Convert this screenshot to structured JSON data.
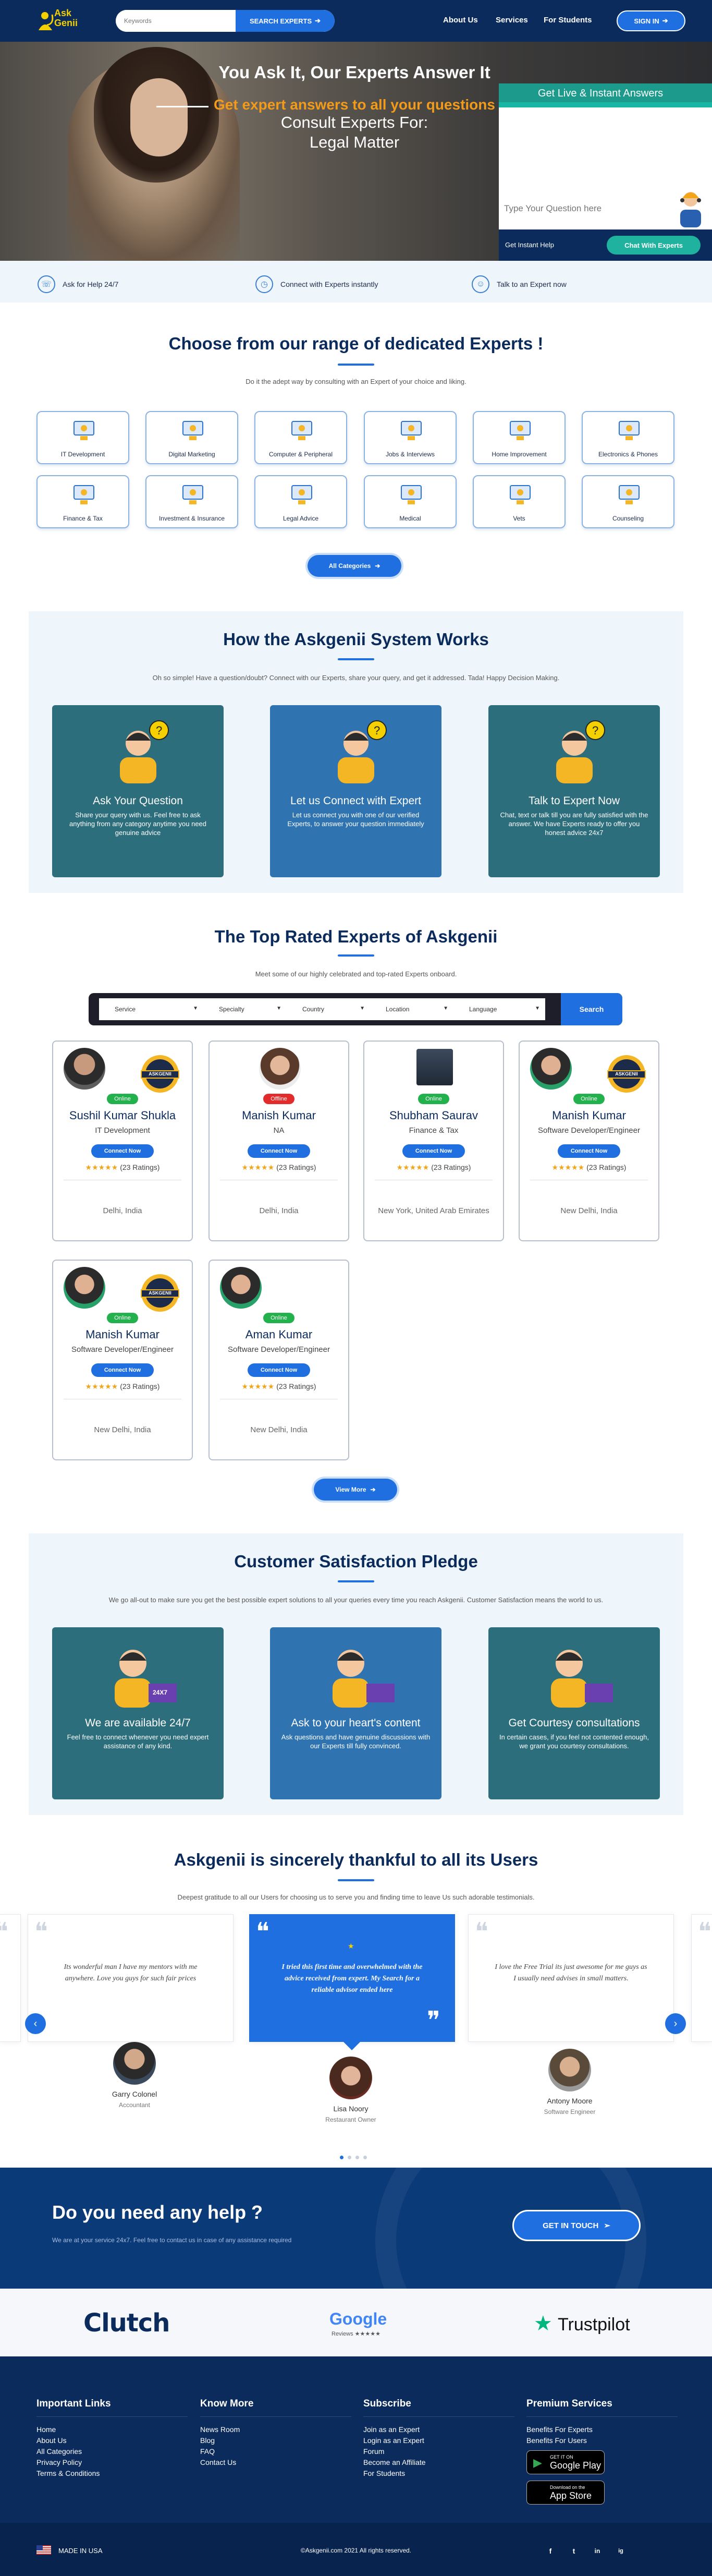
{
  "header": {
    "logo_line1": "Ask",
    "logo_line2": "Genii",
    "search_placeholder": "Keywords",
    "search_button": "SEARCH EXPERTS",
    "nav": [
      "About Us",
      "Services",
      "For Students"
    ],
    "signin": "SIGN IN"
  },
  "hero": {
    "title": "You Ask It, Our Experts Answer It",
    "tagline": "Get expert answers to all your questions",
    "consult": "Consult Experts For:",
    "topic": "Legal Matter",
    "live_title": "Get Live & Instant Answers",
    "question_placeholder": "Type Your Question here",
    "instant_help": "Get Instant Help",
    "chat_button": "Chat With Experts"
  },
  "strip": [
    "Ask for Help 24/7",
    "Connect with Experts instantly",
    "Talk to an Expert now"
  ],
  "categories": {
    "title": "Choose from our range of dedicated Experts !",
    "subtitle": "Do it the adept way by consulting with an Expert of your choice and liking.",
    "items": [
      "IT Development",
      "Digital Marketing",
      "Computer & Peripheral",
      "Jobs & Interviews",
      "Home Improvement",
      "Electronics & Phones",
      "Finance & Tax",
      "Investment & Insurance",
      "Legal Advice",
      "Medical",
      "Vets",
      "Counseling"
    ],
    "button": "All Categories"
  },
  "how": {
    "title": "How the Askgenii System Works",
    "subtitle": "Oh so simple! Have a question/doubt? Connect with our Experts, share your query, and get it addressed. Tada! Happy Decision Making.",
    "cards": [
      {
        "title": "Ask Your Question",
        "text": "Share your query with us. Feel free to ask anything from any category anytime you need genuine advice"
      },
      {
        "title": "Let us Connect with Expert",
        "text": "Let us connect you with one of our verified Experts, to answer your question immediately"
      },
      {
        "title": "Talk to Expert Now",
        "text": "Chat, text or talk till you are fully satisfied with the answer. We have Experts ready to offer you honest advice 24x7"
      }
    ],
    "colors": [
      "#2c6e7c",
      "#2f74b0",
      "#2c6e7c"
    ]
  },
  "experts": {
    "title": "The Top Rated Experts of Askgenii",
    "subtitle": "Meet some of our highly celebrated and top-rated Experts onboard.",
    "filters": [
      "Service",
      "Specialty",
      "Country",
      "Location",
      "Language"
    ],
    "search": "Search",
    "badge_text": "ASKGENII",
    "connect": "Connect Now",
    "stars": "★★★★★",
    "list": [
      {
        "name": "Sushil Kumar Shukla",
        "role": "IT Development",
        "status": "Online",
        "ratings": "(23 Ratings)",
        "location": "Delhi, India",
        "badge": true
      },
      {
        "name": "Manish Kumar",
        "role": "NA",
        "status": "Offline",
        "ratings": "(23 Ratings)",
        "location": "Delhi, India",
        "badge": false
      },
      {
        "name": "Shubham Saurav",
        "role": "Finance & Tax",
        "status": "Online",
        "ratings": "(23 Ratings)",
        "location": "New York, United Arab Emirates",
        "badge": false
      },
      {
        "name": "Manish Kumar",
        "role": "Software Developer/Engineer",
        "status": "Online",
        "ratings": "(23 Ratings)",
        "location": "New Delhi, India",
        "badge": true
      },
      {
        "name": "Manish Kumar",
        "role": "Software Developer/Engineer",
        "status": "Online",
        "ratings": "(23 Ratings)",
        "location": "New Delhi, India",
        "badge": true
      },
      {
        "name": "Aman Kumar",
        "role": "Software Developer/Engineer",
        "status": "Online",
        "ratings": "(23 Ratings)",
        "location": "New Delhi, India",
        "badge": false
      }
    ],
    "view_more": "View More"
  },
  "pledge": {
    "title": "Customer Satisfaction Pledge",
    "subtitle": "We go all-out to make sure you get the best possible expert solutions to all your queries every time you reach Askgenii. Customer Satisfaction means the world to us.",
    "cards": [
      {
        "title": "We are available 24/7",
        "text": "Feel free to connect whenever you need expert assistance of any kind."
      },
      {
        "title": "Ask to your heart's content",
        "text": "Ask questions and have genuine discussions with our Experts till fully convinced."
      },
      {
        "title": "Get Courtesy consultations",
        "text": "In certain cases, if you feel not contented enough, we grant you courtesy consultations."
      }
    ],
    "badge": "24X7"
  },
  "testimonials": {
    "title": "Askgenii is sincerely thankful to all its Users",
    "subtitle": "Deepest gratitude to all our Users for choosing us to serve you and finding time to leave Us such adorable testimonials.",
    "items": [
      {
        "text": "Its wonderful man I have my mentors with me anywhere. Love you guys for such fair prices",
        "name": "Garry Colonel",
        "role": "Accountant"
      },
      {
        "text": "I tried this first time and overwhelmed with the advice received from expert. My Search for a reliable advisor ended here",
        "name": "Lisa Noory",
        "role": "Restaurant Owner"
      },
      {
        "text": "I love the Free Trial its just awesome for me guys as I usually need advises in small matters.",
        "name": "Antony Moore",
        "role": "Software Engineer"
      }
    ]
  },
  "help": {
    "title": "Do you need any help ?",
    "subtitle": "We are at your service 24x7. Feel free to contact us in case of any assistance required",
    "button": "GET IN TOUCH"
  },
  "review_sites": [
    "Clutch",
    "Google",
    "Reviews ★★★★★",
    "Trustpilot"
  ],
  "footer": {
    "cols": [
      {
        "title": "Important Links",
        "items": [
          "Home",
          "About Us",
          "All Categories",
          "Privacy Policy",
          "Terms & Conditions"
        ]
      },
      {
        "title": "Know More",
        "items": [
          "News Room",
          "Blog",
          "FAQ",
          "Contact Us"
        ]
      },
      {
        "title": "Subscribe",
        "items": [
          "Join as an Expert",
          "Login as an Expert",
          "Forum",
          "Become an Affiliate",
          "For Students"
        ]
      },
      {
        "title": "Premium Services",
        "items": [
          "Benefits For Experts",
          "Benefits For Users"
        ]
      }
    ],
    "google_play_small": "GET IT ON",
    "google_play": "Google Play",
    "app_store_small": "Download on the",
    "app_store": "App Store",
    "made_in": "MADE IN USA",
    "copyright": "©Askgenii.com 2021 All rights reserved.",
    "social": [
      "f",
      "t",
      "in",
      "ig"
    ]
  },
  "colors": {
    "navy": "#0b2b5c",
    "blue": "#1f6fe0",
    "teal": "#2c6e7c",
    "orange": "#f29b1b",
    "green": "#23b14d",
    "red": "#e22b2b"
  }
}
